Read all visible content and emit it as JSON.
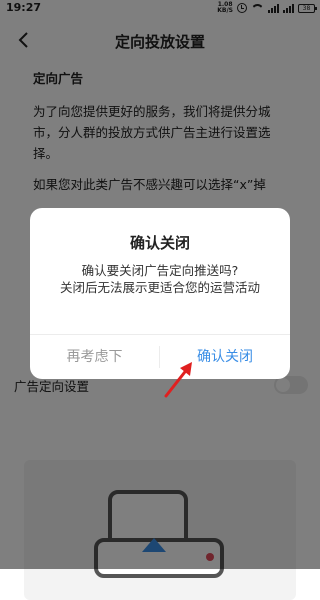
{
  "status_bar": {
    "time": "19:27",
    "net_speed_value": "1.08",
    "net_speed_unit": "KB/S",
    "battery": "38"
  },
  "nav": {
    "title": "定向投放设置"
  },
  "content": {
    "section_title": "定向广告",
    "paragraph_1": "为了向您提供更好的服务，我们将提供分城市，分人群的投放方式供广告主进行设置选择。",
    "paragraph_2": "如果您对此类广告不感兴趣可以选择“x”掉"
  },
  "settings": {
    "ad_targeting_label": "广告定向设置",
    "ad_targeting_enabled": false
  },
  "dialog": {
    "title": "确认关闭",
    "message_line_1": "确认要关闭广告定向推送吗?",
    "message_line_2": "关闭后无法展示更适合您的运营活动",
    "cancel_label": "再考虑下",
    "confirm_label": "确认关闭"
  },
  "colors": {
    "accent": "#3a8ee6",
    "annotation_arrow": "#e02020",
    "overlay": "rgba(0,0,0,0.5)"
  }
}
